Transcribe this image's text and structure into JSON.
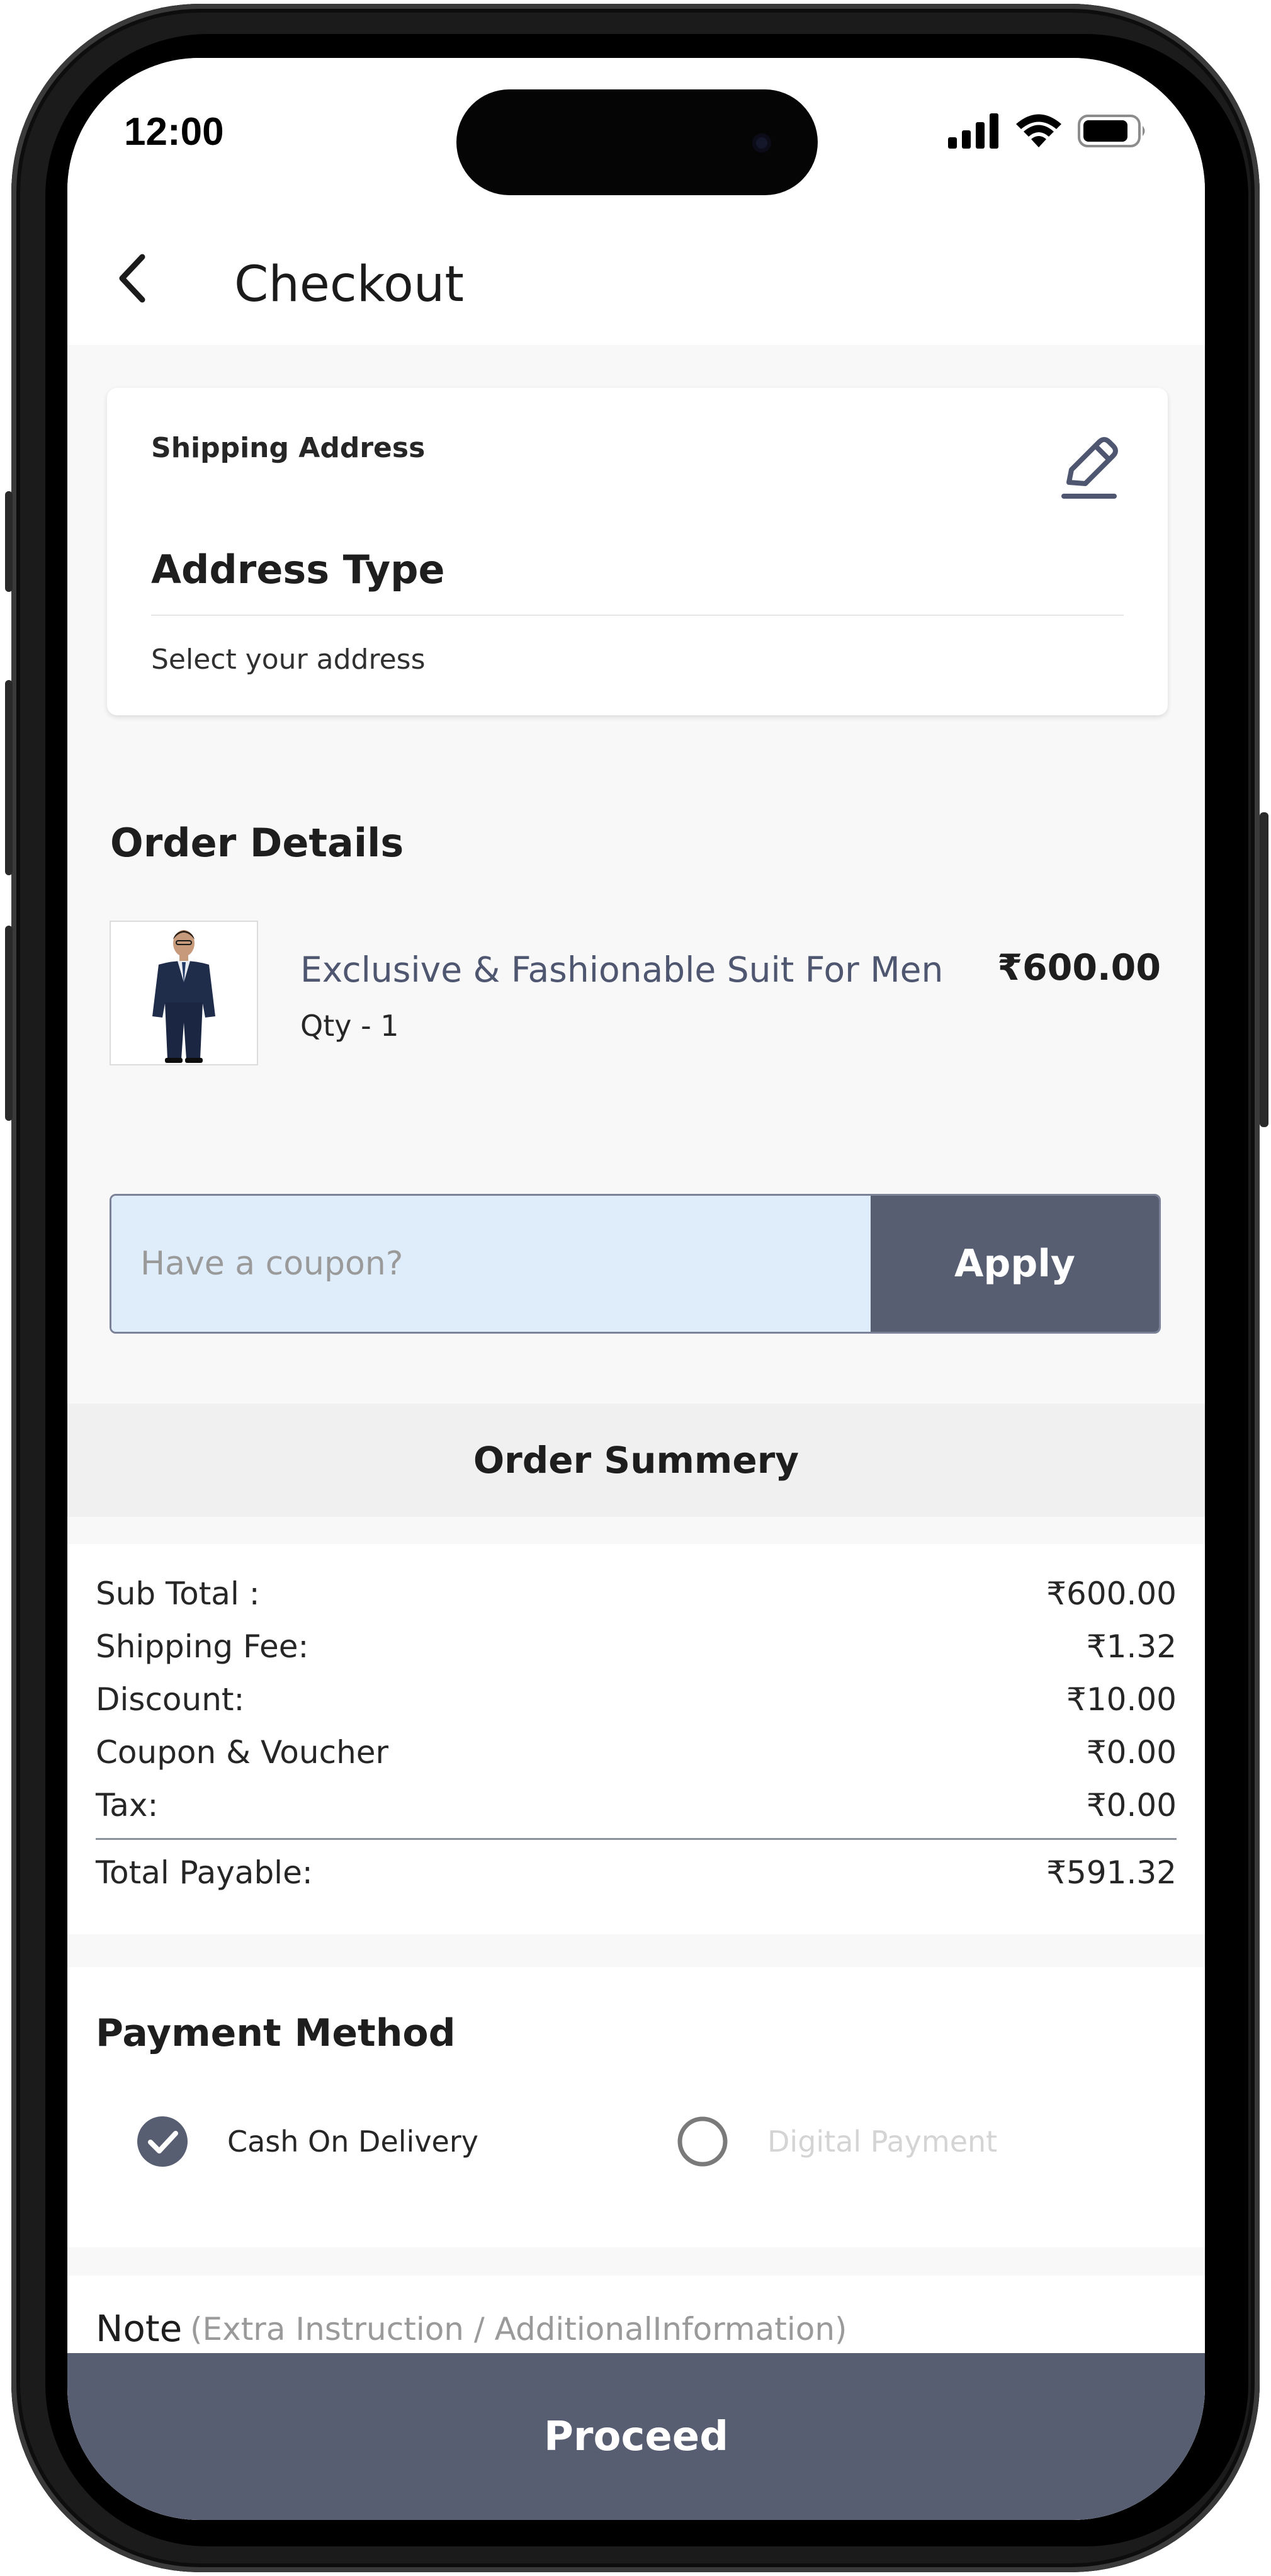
{
  "status_bar": {
    "time": "12:00"
  },
  "header": {
    "title": "Checkout",
    "back_icon": "chevron-left-icon"
  },
  "shipping": {
    "heading": "Shipping Address",
    "edit_icon": "pencil-icon",
    "address_type": "Address Type",
    "select_text": "Select your address"
  },
  "order_details": {
    "title": "Order Details",
    "product": {
      "name": "Exclusive & Fashionable Suit For Men",
      "qty_label": "Qty -  1",
      "price": "₹600.00",
      "image": "suit-product-image"
    }
  },
  "coupon": {
    "placeholder": "Have a coupon?",
    "apply_label": "Apply"
  },
  "summary": {
    "title": "Order Summery",
    "rows": [
      {
        "label": "Sub Total :",
        "value": "₹600.00"
      },
      {
        "label": "Shipping Fee:",
        "value": "₹1.32"
      },
      {
        "label": "Discount:",
        "value": "₹10.00"
      },
      {
        "label": "Coupon & Voucher",
        "value": "₹0.00"
      },
      {
        "label": "Tax:",
        "value": "₹0.00"
      }
    ],
    "total": {
      "label": "Total Payable:",
      "value": "₹591.32"
    }
  },
  "payment": {
    "title": "Payment Method",
    "options": [
      {
        "label": "Cash On Delivery",
        "selected": true
      },
      {
        "label": "Digital Payment",
        "selected": false
      }
    ]
  },
  "note": {
    "label": "Note",
    "hint": "(Extra Instruction / AdditionalInformation)"
  },
  "proceed": {
    "label": "Proceed"
  },
  "colors": {
    "primary": "#585e72",
    "coupon_bg": "#dfedfb",
    "product_name": "#4e5670"
  }
}
